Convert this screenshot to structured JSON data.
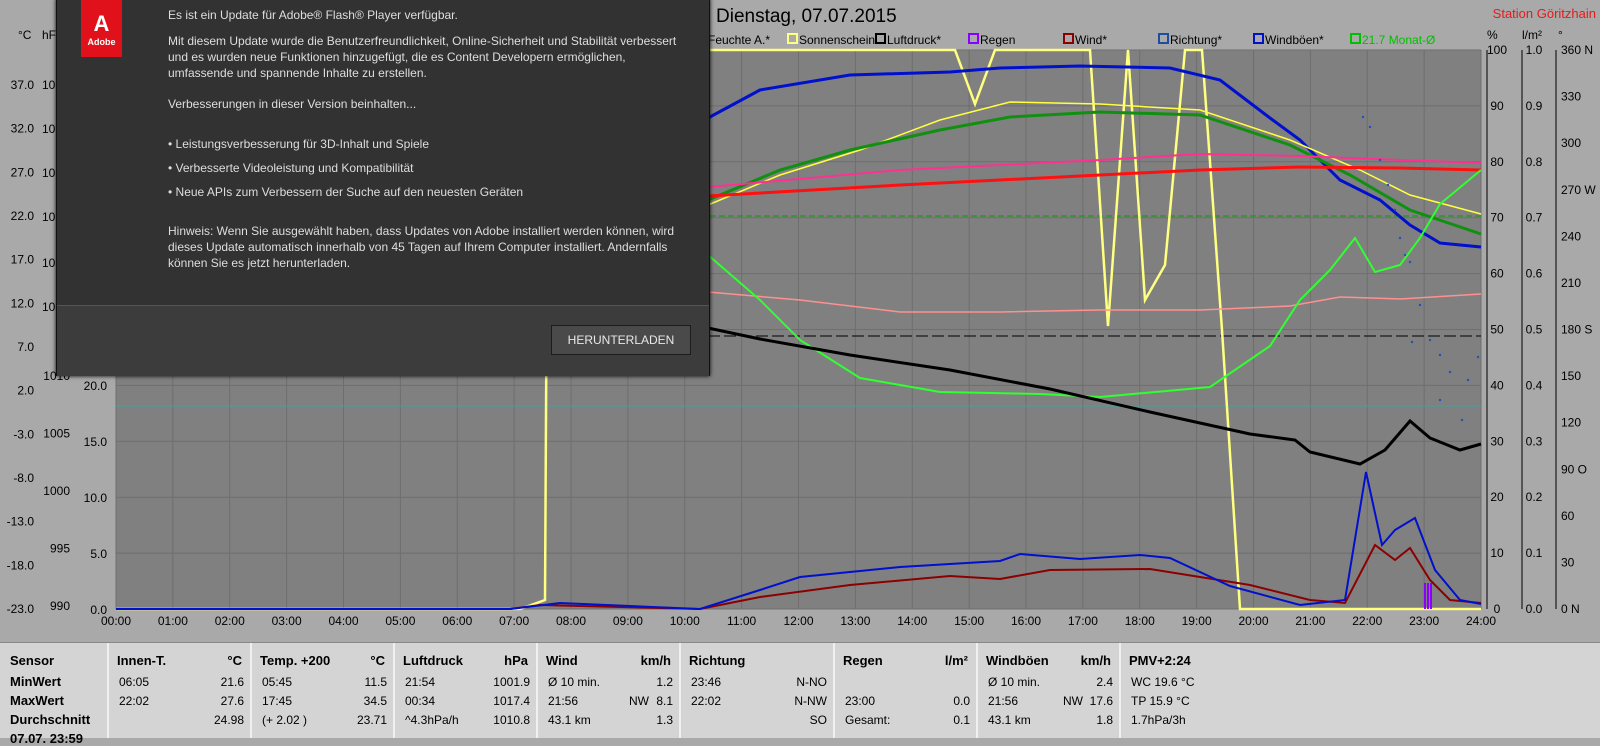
{
  "chart": {
    "title": "Dienstag, 07.07.2015",
    "station": "Station Göritzhain",
    "units": {
      "temp": "°C",
      "press": "hPa",
      "pct": "%",
      "rain": "l/m²",
      "dir": "°"
    },
    "legend": [
      {
        "label": "Feuchte A.*",
        "color": "#ff9090"
      },
      {
        "label": "Sonnenschein",
        "color": "#ffff80"
      },
      {
        "label": "Luftdruck*",
        "color": "#000000"
      },
      {
        "label": "Regen",
        "color": "#8a00ff"
      },
      {
        "label": "Wind*",
        "color": "#8b0000"
      },
      {
        "label": "Richtung*",
        "color": "#1f4e9e"
      },
      {
        "label": "Windböen*",
        "color": "#0010cc"
      },
      {
        "label": "21.7 Monat-Ø",
        "color": "#00c000"
      }
    ],
    "temp_ticks": [
      "37.0",
      "32.0",
      "27.0",
      "22.0",
      "17.0",
      "12.0",
      "7.0",
      "2.0",
      "-3.0",
      "-8.0",
      "-13.0",
      "-18.0",
      "-23.0"
    ],
    "press_ticks": [
      "1010",
      "1005",
      "1000",
      "995",
      "990"
    ],
    "press_ticks_partial": [
      "10",
      "10",
      "10",
      "10",
      "10",
      "10"
    ],
    "wind_ticks": [
      "20.0",
      "15.0",
      "10.0",
      "5.0",
      "0.0"
    ],
    "pct_ticks": [
      "100",
      "90",
      "80",
      "70",
      "60",
      "50",
      "40",
      "30",
      "20",
      "10",
      "0"
    ],
    "rain_ticks": [
      "1.0",
      "0.9",
      "0.8",
      "0.7",
      "0.6",
      "0.5",
      "0.4",
      "0.3",
      "0.2",
      "0.1",
      "0.0"
    ],
    "dir_ticks": [
      "360 N",
      "330",
      "300",
      "270 W",
      "240",
      "210",
      "180 S",
      "150",
      "120",
      "90 O",
      "60",
      "30",
      "0 N"
    ],
    "time_ticks": [
      "00:00",
      "01:00",
      "02:00",
      "03:00",
      "04:00",
      "05:00",
      "06:00",
      "07:00",
      "08:00",
      "09:00",
      "10:00",
      "11:00",
      "12:00",
      "13:00",
      "14:00",
      "15:00",
      "16:00",
      "17:00",
      "18:00",
      "19:00",
      "20:00",
      "21:00",
      "22:00",
      "23:00",
      "24:00"
    ],
    "axis_units_left": "°C",
    "axis_units_left2": "hF"
  },
  "popup": {
    "logo_text": "Adobe",
    "heading": "Es ist ein Update für Adobe® Flash® Player verfügbar.",
    "p1": "Mit diesem Update wurde die Benutzerfreundlichkeit, Online-Sicherheit und Stabilität verbessert und es wurden neue Funktionen hinzugefügt, die es Content Developern ermöglichen, umfassende und spannende Inhalte zu erstellen.",
    "p2": "Verbesserungen in dieser Version beinhalten...",
    "b1": "• Leistungsverbesserung für 3D-Inhalt und Spiele",
    "b2": "• Verbesserte Videoleistung und Kompatibilität",
    "b3": "• Neue APIs zum Verbessern der Suche auf den neuesten Geräten",
    "note": "Hinweis: Wenn Sie ausgewählt haben, dass Updates von Adobe installiert werden können, wird dieses Update automatisch innerhalb von 45 Tagen auf Ihrem Computer installiert. Andernfalls können Sie es jetzt herunterladen.",
    "button": "HERUNTERLADEN"
  },
  "stats": {
    "labels": {
      "sensor": "Sensor",
      "min": "MinWert",
      "max": "MaxWert",
      "avg": "Durchschnitt",
      "last": "07.07. 23:59"
    },
    "innen": {
      "h": "Innen-T.",
      "u": "°C",
      "min_t": "06:05",
      "min_v": "21.6",
      "max_t": "22:02",
      "max_v": "27.6",
      "avg_v": "24.98"
    },
    "temp": {
      "h": "Temp. +200",
      "u": "°C",
      "min_t": "05:45",
      "min_v": "11.5",
      "max_t": "17:45",
      "max_v": "34.5",
      "avg_t": "(+ 2.02 )",
      "avg_v": "23.71"
    },
    "press": {
      "h": "Luftdruck",
      "u": "hPa",
      "min_t": "21:54",
      "min_v": "1001.9",
      "max_t": "00:34",
      "max_v": "1017.4",
      "avg_t": "^4.3hPa/h",
      "avg_v": "1010.8"
    },
    "wind": {
      "h": "Wind",
      "u": "km/h",
      "min_t": "Ø 10 min.",
      "min_v": "1.2",
      "max_t": "21:56",
      "max_m": "NW",
      "max_v": "8.1",
      "avg_t": "43.1 km",
      "avg_v": "1.3"
    },
    "dir": {
      "h": "Richtung",
      "u": "",
      "min_t": "23:46",
      "min_v": "N-NO",
      "max_t": "22:02",
      "max_v": "N-NW",
      "avg_v": "SO"
    },
    "rain": {
      "h": "Regen",
      "u": "l/m²",
      "max_t": "23:00",
      "max_v": "0.0",
      "avg_t": "Gesamt:",
      "avg_v": "0.1"
    },
    "gust": {
      "h": "Windböen",
      "u": "km/h",
      "min_t": "Ø 10 min.",
      "min_v": "2.4",
      "max_t": "21:56",
      "max_m": "NW",
      "max_v": "17.6",
      "avg_t": "43.1 km",
      "avg_v": "1.8"
    },
    "pmv": {
      "h": "PMV+2:24",
      "min_v": "WC 19.6 °C",
      "max_v": "TP 15.9 °C",
      "avg_v": "1.7hPa/3h"
    }
  }
}
